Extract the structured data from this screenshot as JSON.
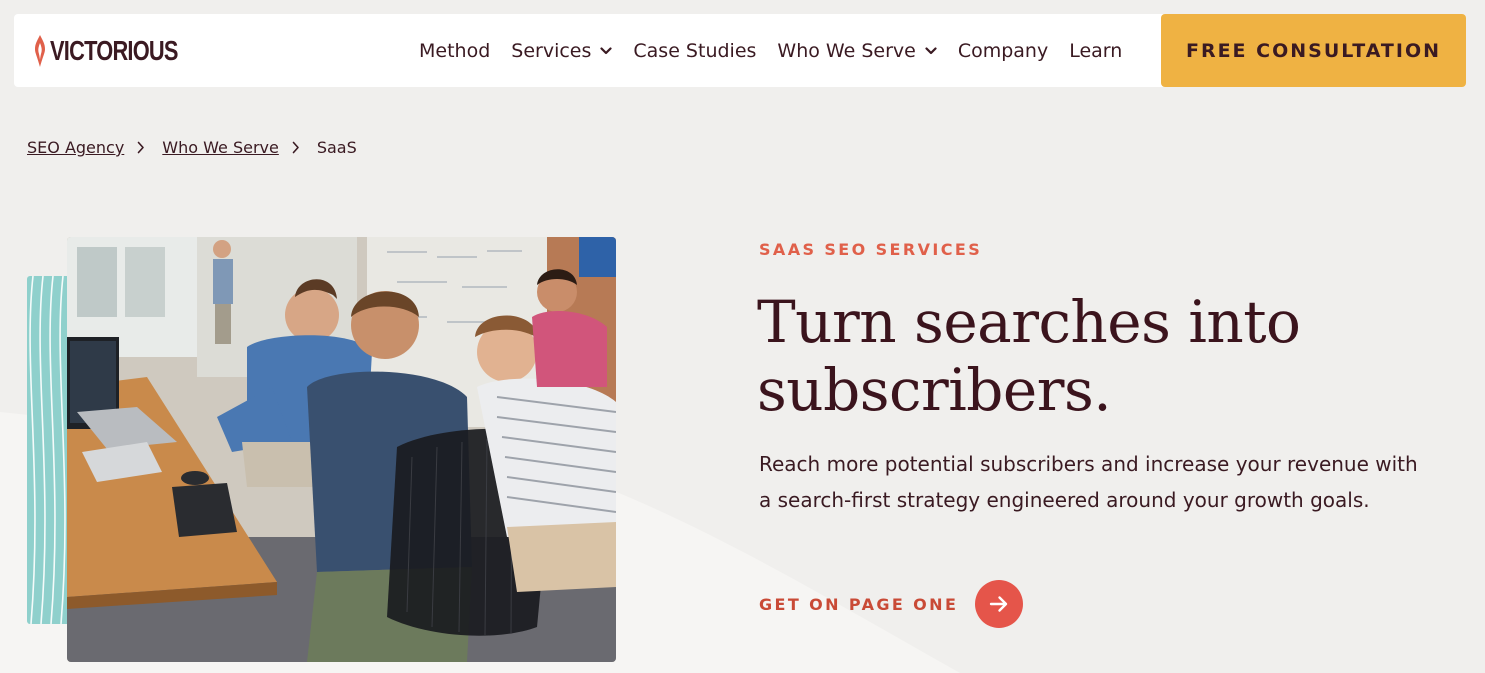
{
  "brand": {
    "name": "VICTORIOUS",
    "logo_icon": "flame-icon",
    "accent_color": "#e0604a",
    "cta_color": "#efb243",
    "text_color": "#3b141d"
  },
  "nav": {
    "items": [
      {
        "label": "Method",
        "has_dropdown": false
      },
      {
        "label": "Services",
        "has_dropdown": true
      },
      {
        "label": "Case Studies",
        "has_dropdown": false
      },
      {
        "label": "Who We Serve",
        "has_dropdown": true
      },
      {
        "label": "Company",
        "has_dropdown": false
      },
      {
        "label": "Learn",
        "has_dropdown": false
      }
    ],
    "cta_label": "FREE CONSULTATION"
  },
  "breadcrumb": {
    "items": [
      "SEO Agency",
      "Who We Serve",
      "SaaS"
    ]
  },
  "hero": {
    "eyebrow": "SAAS SEO SERVICES",
    "headline_line1": "Turn searches into",
    "headline_line2": "subscribers.",
    "lede_line1": "Reach more potential subscribers and increase your revenue with",
    "lede_line2": "a search-first strategy engineered around your growth goals.",
    "cta_label": "GET ON PAGE ONE",
    "cta_icon": "arrow-right-icon"
  }
}
